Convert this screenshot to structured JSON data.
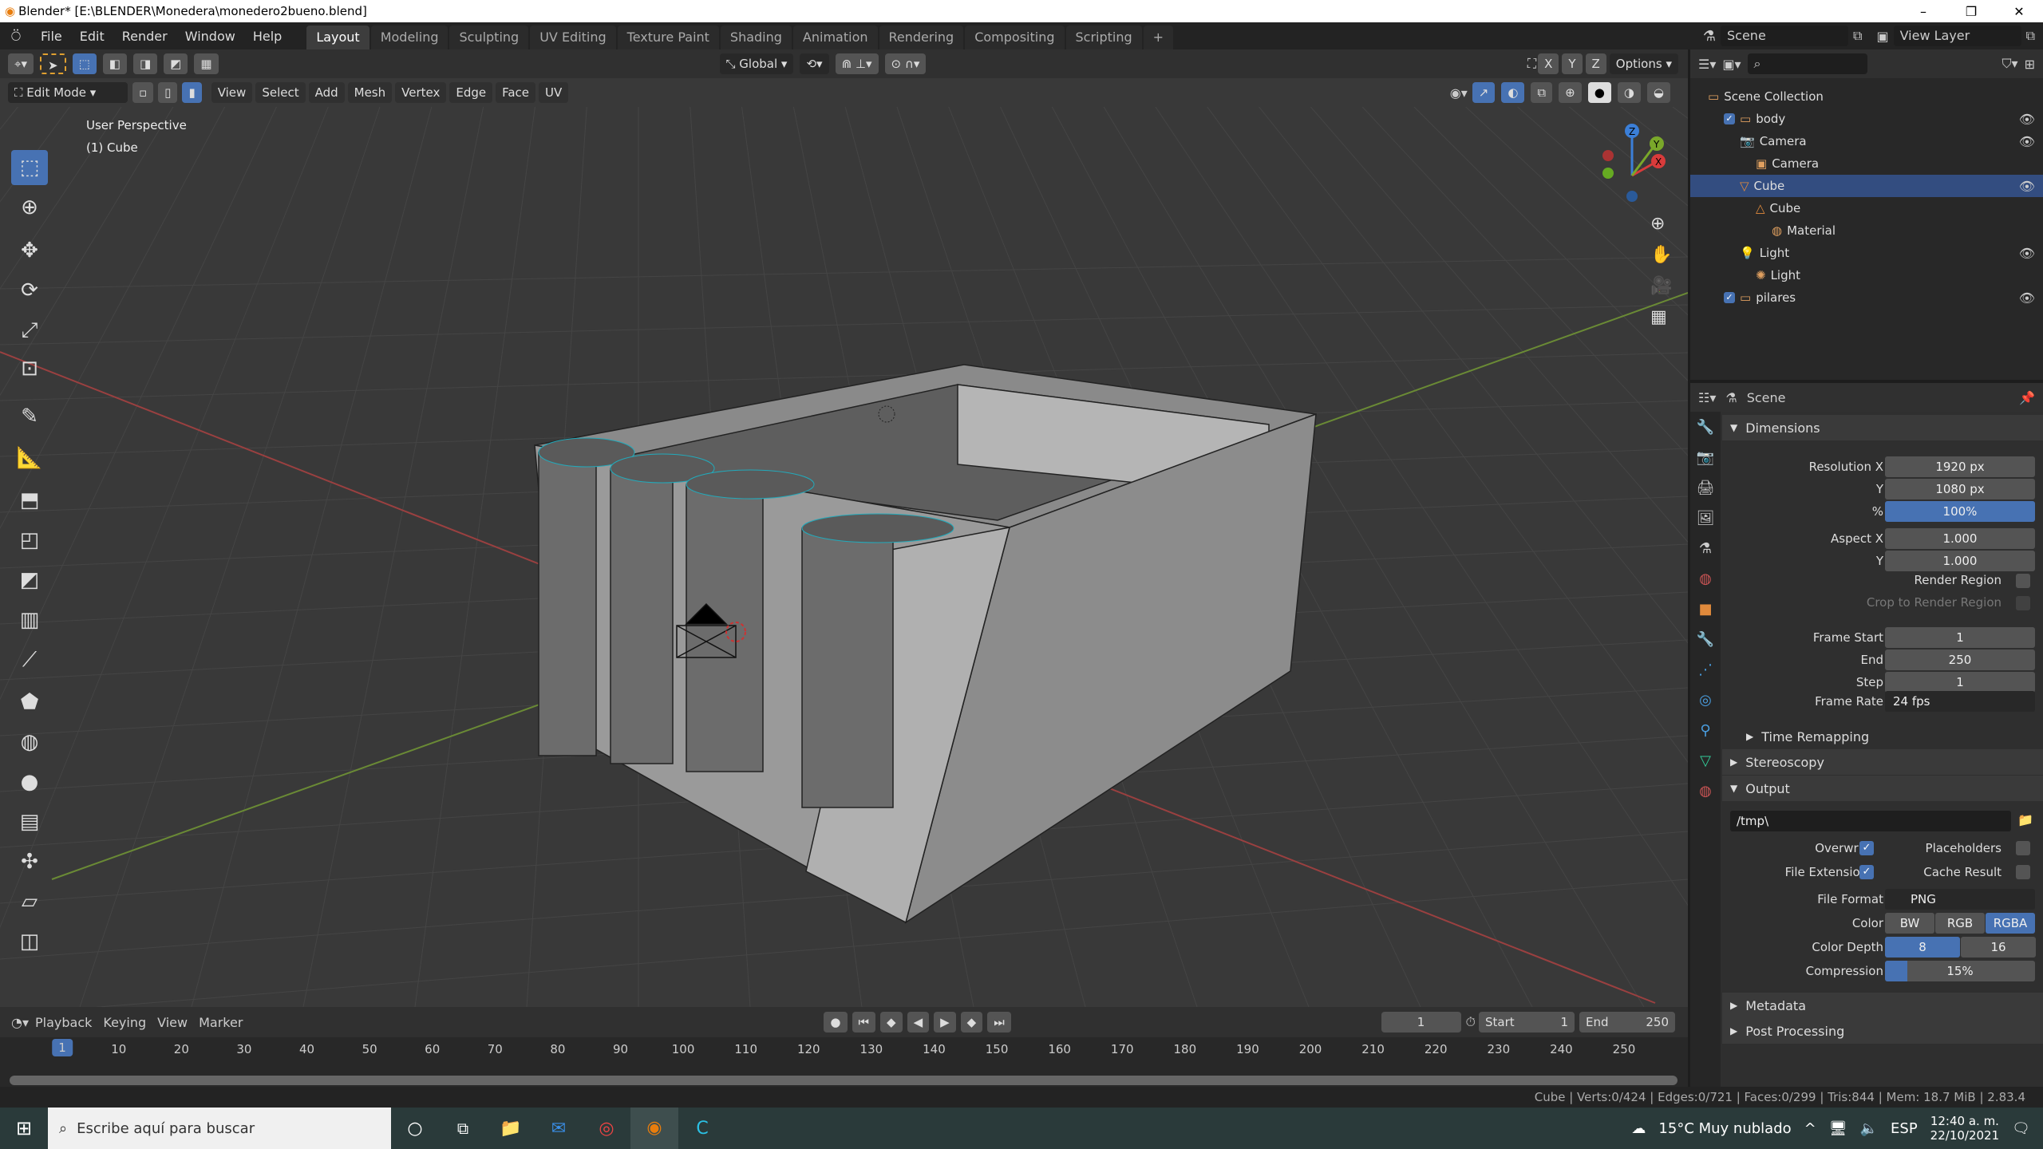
{
  "window": {
    "title": "Blender* [E:\\BLENDER\\Monedera\\monedero2bueno.blend]",
    "minimize": "–",
    "maximize": "❐",
    "close": "✕"
  },
  "menu": [
    "File",
    "Edit",
    "Render",
    "Window",
    "Help"
  ],
  "workspaces": [
    "Layout",
    "Modeling",
    "Sculpting",
    "UV Editing",
    "Texture Paint",
    "Shading",
    "Animation",
    "Rendering",
    "Compositing",
    "Scripting"
  ],
  "workspace_add": "+",
  "scene": {
    "name": "Scene",
    "view_layer": "View Layer"
  },
  "viewport": {
    "orientation": "Global",
    "options": "Options",
    "axes": [
      "X",
      "Y",
      "Z"
    ],
    "mode": "Edit Mode",
    "menus": [
      "View",
      "Select",
      "Add",
      "Mesh",
      "Vertex",
      "Edge",
      "Face",
      "UV"
    ],
    "overlay_text": "User Perspective",
    "overlay_object": "(1) Cube",
    "gizmo": {
      "x": "X",
      "y": "Y",
      "z": "Z"
    }
  },
  "outliner": {
    "search_placeholder": "",
    "items": [
      {
        "label": "Scene Collection",
        "depth": 0,
        "icon": "collection-icon",
        "eye": false
      },
      {
        "label": "body",
        "depth": 1,
        "icon": "collection-icon",
        "eye": true,
        "check": true
      },
      {
        "label": "Camera",
        "depth": 2,
        "icon": "camera-icon",
        "eye": true
      },
      {
        "label": "Camera",
        "depth": 3,
        "icon": "camera-data-icon",
        "eye": false
      },
      {
        "label": "Cube",
        "depth": 2,
        "icon": "mesh-object-icon",
        "eye": true,
        "selected": true
      },
      {
        "label": "Cube",
        "depth": 3,
        "icon": "mesh-data-icon",
        "eye": false
      },
      {
        "label": "Material",
        "depth": 4,
        "icon": "material-icon",
        "eye": false
      },
      {
        "label": "Light",
        "depth": 2,
        "icon": "light-icon",
        "eye": true
      },
      {
        "label": "Light",
        "depth": 3,
        "icon": "light-data-icon",
        "eye": false
      },
      {
        "label": "pilares",
        "depth": 1,
        "icon": "collection-icon",
        "eye": true,
        "check": true
      }
    ]
  },
  "properties": {
    "context": "Scene",
    "dimensions": {
      "title": "Dimensions",
      "resolution_x_label": "Resolution X",
      "resolution_x": "1920 px",
      "y_label": "Y",
      "resolution_y": "1080 px",
      "percent_label": "%",
      "percent": "100%",
      "aspect_x_label": "Aspect X",
      "aspect_x": "1.000",
      "aspect_y": "1.000",
      "render_region": "Render Region",
      "crop": "Crop to Render Region",
      "frame_start_label": "Frame Start",
      "frame_start": "1",
      "end_label": "End",
      "frame_end": "250",
      "step_label": "Step",
      "step": "1",
      "frame_rate_label": "Frame Rate",
      "frame_rate": "24 fps"
    },
    "time_remapping": "Time Remapping",
    "stereoscopy": "Stereoscopy",
    "output": {
      "title": "Output",
      "path": "/tmp\\",
      "overwrite": "Overwrite",
      "placeholders": "Placeholders",
      "file_extensions": "File Extensions",
      "cache_result": "Cache Result",
      "file_format_label": "File Format",
      "file_format": "PNG",
      "color_label": "Color",
      "color_options": [
        "BW",
        "RGB",
        "RGBA"
      ],
      "color_selected": "RGBA",
      "depth_label": "Color Depth",
      "depth_options": [
        "8",
        "16"
      ],
      "depth_selected": "8",
      "compression_label": "Compression",
      "compression": "15%",
      "compression_value": 15
    },
    "metadata": "Metadata",
    "post_processing": "Post Processing"
  },
  "timeline": {
    "menus": [
      "Playback",
      "Keying",
      "View",
      "Marker"
    ],
    "current_frame": "1",
    "start_label": "Start",
    "start": "1",
    "end_label": "End",
    "end": "250",
    "ticks": [
      "1",
      "10",
      "20",
      "30",
      "40",
      "50",
      "60",
      "70",
      "80",
      "90",
      "100",
      "110",
      "120",
      "130",
      "140",
      "150",
      "160",
      "170",
      "180",
      "190",
      "200",
      "210",
      "220",
      "230",
      "240",
      "250"
    ]
  },
  "status": "Cube | Verts:0/424 | Edges:0/721 | Faces:0/299 | Tris:844 | Mem: 18.7 MiB | 2.83.4",
  "taskbar": {
    "search_placeholder": "Escribe aquí para buscar",
    "weather": "15°C  Muy nublado",
    "lang": "ESP",
    "time": "12:40 a. m.",
    "date": "22/10/2021"
  },
  "colors": {
    "accent": "#4772b3",
    "selection": "#334d80",
    "orange": "#e87d0d"
  }
}
